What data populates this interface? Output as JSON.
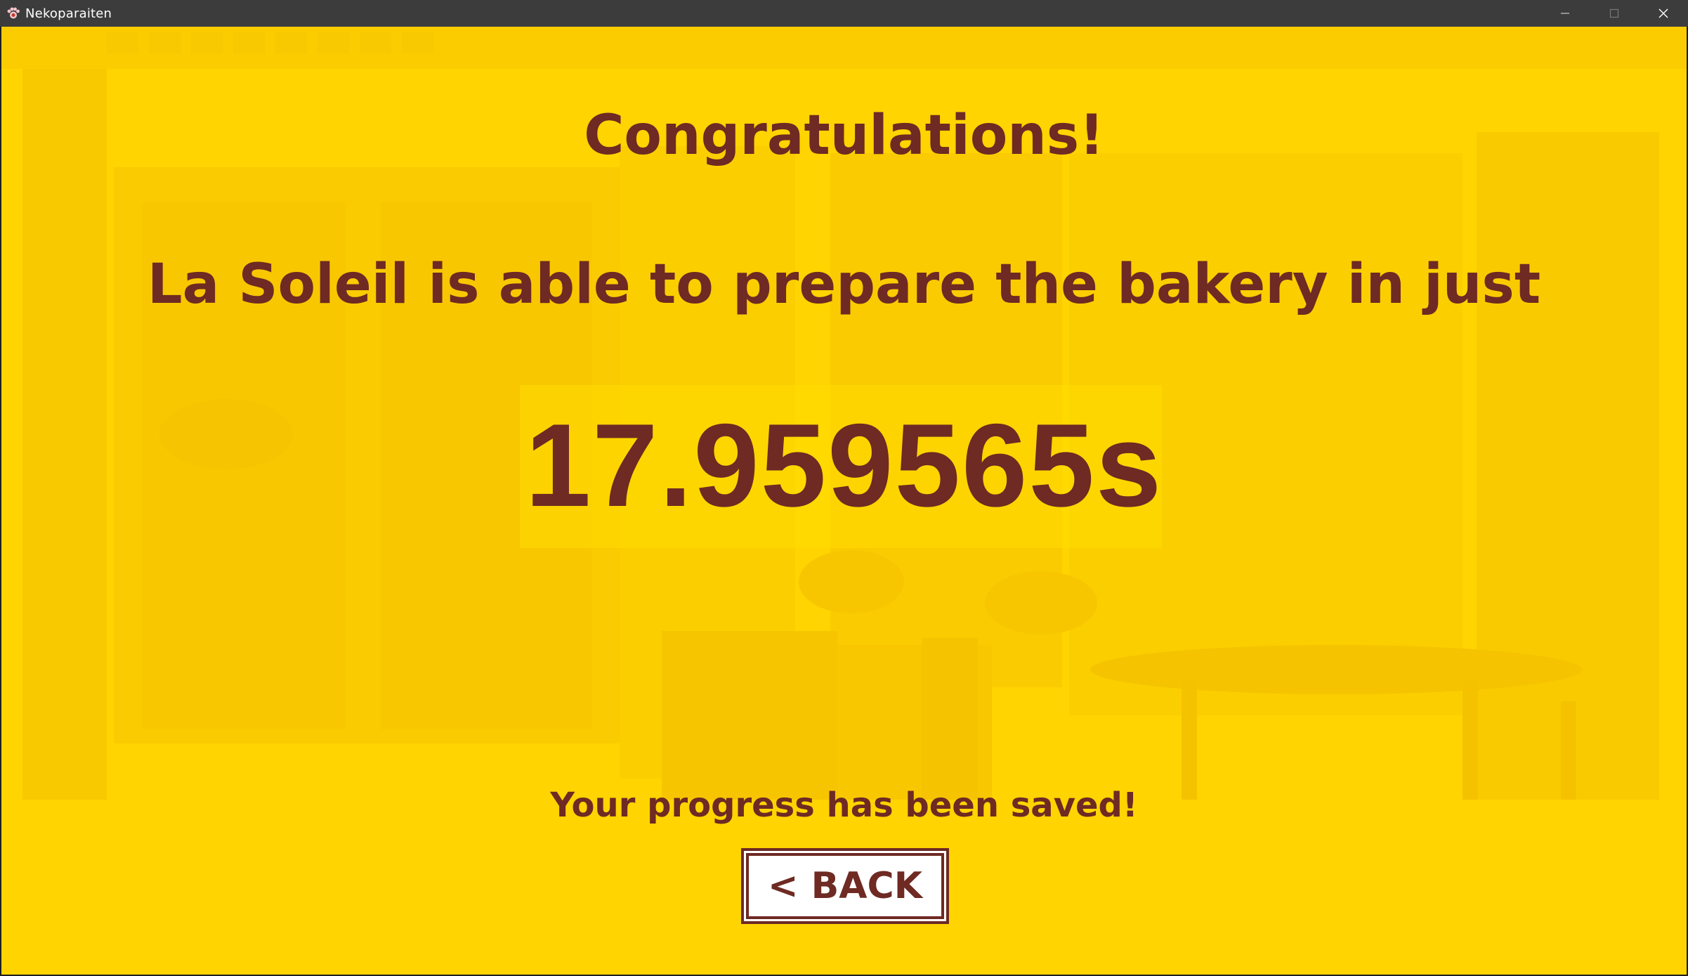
{
  "window": {
    "title": "Nekoparaiten",
    "app_icon": "paw-icon",
    "controls": [
      "minimize-icon",
      "maximize-icon",
      "close-icon"
    ]
  },
  "result_screen": {
    "heading": "Congratulations!",
    "message": "La Soleil is able to prepare the bakery in just",
    "time": "17.959565s",
    "saved_notice": "Your progress has been saved!",
    "back_button_label": "< BACK"
  },
  "colors": {
    "text": "#6e2a23",
    "background": "#ffd000",
    "titlebar": "#3c3c3c"
  }
}
